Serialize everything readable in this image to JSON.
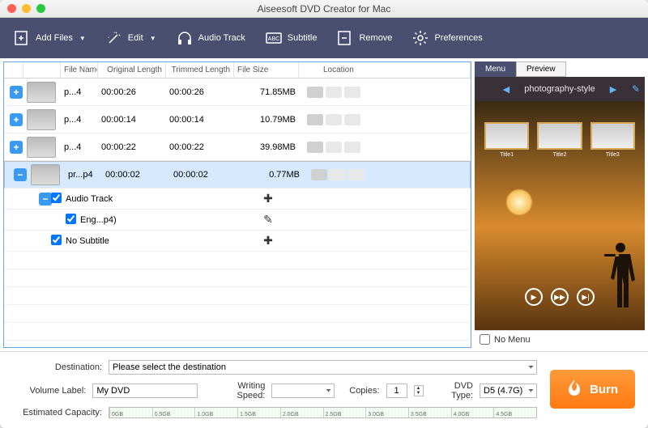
{
  "titlebar": {
    "title": "Aiseesoft DVD Creator for Mac"
  },
  "toolbar": {
    "addFiles": "Add Files",
    "edit": "Edit",
    "audioTrack": "Audio Track",
    "subtitle": "Subtitle",
    "remove": "Remove",
    "preferences": "Preferences"
  },
  "table": {
    "headers": {
      "fileName": "File Name",
      "originalLength": "Original Length",
      "trimmedLength": "Trimmed Length",
      "fileSize": "File Size",
      "location": "Location"
    },
    "rows": [
      {
        "toggle": "+",
        "name": "p...4",
        "orig": "00:00:26",
        "trim": "00:00:26",
        "size": "71.85MB",
        "selected": false
      },
      {
        "toggle": "+",
        "name": "p...4",
        "orig": "00:00:14",
        "trim": "00:00:14",
        "size": "10.79MB",
        "selected": false
      },
      {
        "toggle": "+",
        "name": "p...4",
        "orig": "00:00:22",
        "trim": "00:00:22",
        "size": "39.98MB",
        "selected": false
      },
      {
        "toggle": "-",
        "name": "pr...p4",
        "orig": "00:00:02",
        "trim": "00:00:02",
        "size": "0.77MB",
        "selected": true
      }
    ],
    "sub": {
      "audioGroup": "Audio Track",
      "audioItem": "Eng...p4)",
      "subtitleItem": "No Subtitle",
      "plus": "✚",
      "pencil": "✎"
    }
  },
  "rightPanel": {
    "tabs": {
      "menu": "Menu",
      "preview": "Preview"
    },
    "themeName": "photography-style",
    "frames": [
      {
        "title": "Title1"
      },
      {
        "title": "Title2"
      },
      {
        "title": "Title3"
      }
    ],
    "noMenu": "No Menu"
  },
  "bottom": {
    "destinationLabel": "Destination:",
    "destinationValue": "Please select the destination",
    "volumeLabel": "Volume Label:",
    "volumeValue": "My DVD",
    "writingSpeedLabel": "Writing Speed:",
    "writingSpeedValue": "",
    "copiesLabel": "Copies:",
    "copiesValue": "1",
    "dvdTypeLabel": "DVD Type:",
    "dvdTypeValue": "D5 (4.7G)",
    "capacityLabel": "Estimated Capacity:",
    "capacityTicks": [
      "0GB",
      "0.5GB",
      "1.0GB",
      "1.5GB",
      "2.0GB",
      "2.5GB",
      "3.0GB",
      "3.5GB",
      "4.0GB",
      "4.5GB"
    ],
    "burn": "Burn"
  }
}
